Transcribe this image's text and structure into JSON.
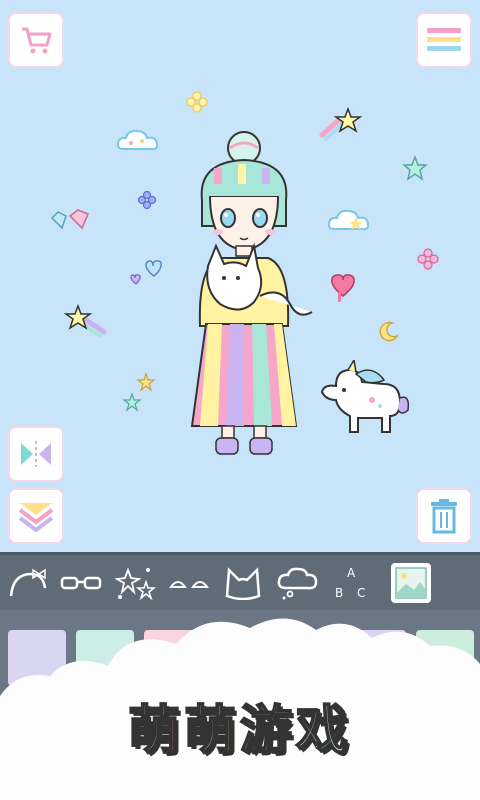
{
  "banner": {
    "chars": [
      "萌",
      "萌",
      "游",
      "戏"
    ],
    "colors": [
      "#ff9fc8",
      "#ffe08a",
      "#a0dcff",
      "#c5f0d6"
    ]
  },
  "buttons": {
    "shop_icon": "shopping-cart-icon",
    "menu_icon": "hamburger-menu-icon",
    "flip_icon": "mirror-flip-icon",
    "layers_icon": "layer-down-icon",
    "trash_icon": "trash-can-icon"
  },
  "toolbar": {
    "categories": [
      "headband",
      "glasses",
      "sparkles",
      "eyebrows",
      "cat-ears",
      "speech-cloud",
      "letters",
      "background"
    ],
    "letters_text": "ABC"
  },
  "palette": {
    "swatch_colors": [
      "#d9d6f2",
      "#cdeee7",
      "#f9d6df",
      "#fbf0c8",
      "#eaf3fb",
      "#d9d3f4",
      "#cdeede"
    ]
  },
  "colors": {
    "stage_bg": "#c7e4f8",
    "toolbar_bg": "#5f6b77",
    "accent_pink": "#f3a9cf"
  }
}
